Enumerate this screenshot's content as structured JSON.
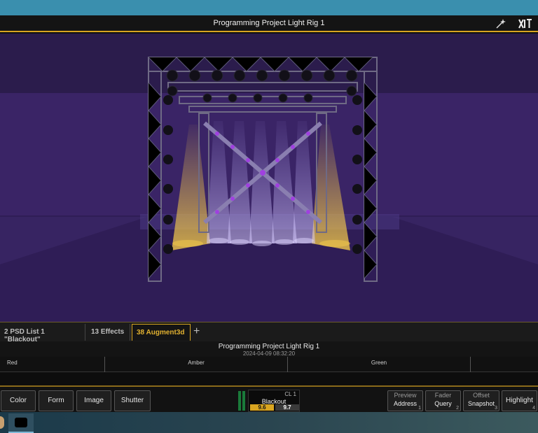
{
  "window": {
    "title": "Programming Project Light Rig 1"
  },
  "tabs": [
    {
      "label": "2 PSD List 1 \"Blackout\""
    },
    {
      "label": "13 Effects"
    },
    {
      "label": "38 Augment3d"
    }
  ],
  "list": {
    "name": "Programming Project Light Rig 1",
    "timestamp": "2024-04-09 08:32:20",
    "columns": [
      "Red",
      "Amber",
      "Green"
    ]
  },
  "softkeys": {
    "color": "Color",
    "form": "Form",
    "image": "Image",
    "shutter": "Shutter",
    "preview": {
      "sub": "Preview",
      "main": "Address",
      "num": "1"
    },
    "fader": {
      "sub": "Fader",
      "main": "Query",
      "num": "2"
    },
    "offset": {
      "sub": "Offset",
      "main": "Snapshot",
      "num": "3"
    },
    "highlight": {
      "main": "Highlight",
      "num": "4"
    }
  },
  "cue": {
    "list": "CL 1",
    "label": "Blackout",
    "a": "9.6",
    "b": "9.7"
  },
  "colors": {
    "accent": "#d9a520",
    "stage": "#2e1d52",
    "beam_white": "#b8a8ff",
    "beam_amber": "#f2c84a"
  },
  "icons": {
    "wand": "magic-wand-icon",
    "logo": "eos-logo-icon"
  }
}
